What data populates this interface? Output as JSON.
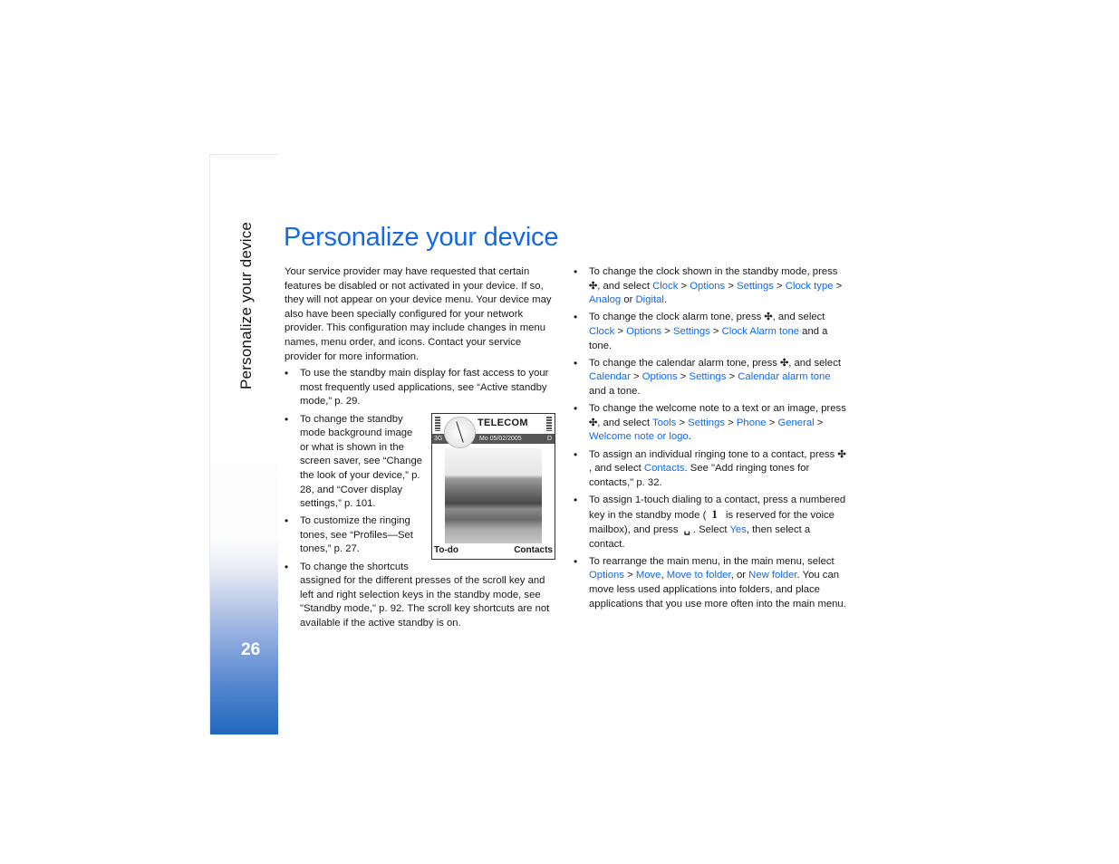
{
  "sidebar": {
    "section_title": "Personalize your device",
    "page_number": "26"
  },
  "page_title": "Personalize your device",
  "colors": {
    "link": "#1468e8",
    "sidebar_gradient_bottom": "#1f68bd"
  },
  "left_column": {
    "intro": [
      {
        "t": "Your service provider may have requested that certain features be disabled or not activated in your device. If so, they will not appear on your device menu. Your device may also have been specially configured for your network provider. This configuration may include changes in menu names, menu order, and icons. Contact your service provider for more information."
      }
    ],
    "bullets": [
      [
        {
          "t": "To use the standby main display for fast access to your most frequently used applications, see “Active standby mode,” p. 29."
        }
      ],
      [
        {
          "t": "To change the standby mode background image or what is shown in the screen saver, see “Change the look of your device,” p. 28, and “Cover display settings,” p. 101."
        }
      ],
      [
        {
          "t": "To customize the ringing tones, see “Profiles—Set tones,” p. 27."
        }
      ],
      [
        {
          "t": "To change the shortcuts assigned for the different presses of the scroll key and left and right selection keys in the standby mode, see \"Standby mode,\" p. 92. The scroll key shortcuts are not available if the active standby is on."
        }
      ]
    ]
  },
  "phone_screen": {
    "operator": "TELECOM",
    "network": "3G",
    "date": "Mo 05/02/2005",
    "indicator": "D",
    "left_softkey": "To-do",
    "right_softkey": "Contacts"
  },
  "right_column": {
    "bullets": [
      [
        {
          "t": "To change the clock shown in the standby mode, press "
        },
        {
          "icon": "menu-key"
        },
        {
          "t": ", and select "
        },
        {
          "l": "Clock"
        },
        {
          "t": " > "
        },
        {
          "l": "Options"
        },
        {
          "t": " > "
        },
        {
          "l": "Settings"
        },
        {
          "t": " > "
        },
        {
          "l": "Clock type"
        },
        {
          "t": " > "
        },
        {
          "l": "Analog"
        },
        {
          "t": " or "
        },
        {
          "l": "Digital"
        },
        {
          "t": "."
        }
      ],
      [
        {
          "t": "To change the clock alarm tone, press "
        },
        {
          "icon": "menu-key"
        },
        {
          "t": ", and select "
        },
        {
          "l": "Clock"
        },
        {
          "t": " > "
        },
        {
          "l": "Options"
        },
        {
          "t": " > "
        },
        {
          "l": "Settings"
        },
        {
          "t": " > "
        },
        {
          "l": "Clock Alarm tone"
        },
        {
          "t": " and a tone."
        }
      ],
      [
        {
          "t": "To change the calendar alarm tone, press "
        },
        {
          "icon": "menu-key"
        },
        {
          "t": ", and select "
        },
        {
          "l": "Calendar"
        },
        {
          "t": " > "
        },
        {
          "l": "Options"
        },
        {
          "t": " > "
        },
        {
          "l": "Settings"
        },
        {
          "t": " > "
        },
        {
          "l": "Calendar alarm tone"
        },
        {
          "t": " and a tone."
        }
      ],
      [
        {
          "t": "To change the welcome note to a text or an image, press "
        },
        {
          "icon": "menu-key"
        },
        {
          "t": ", and select "
        },
        {
          "l": "Tools"
        },
        {
          "t": " > "
        },
        {
          "l": "Settings"
        },
        {
          "t": " > "
        },
        {
          "l": "Phone"
        },
        {
          "t": " > "
        },
        {
          "l": "General"
        },
        {
          "t": " > "
        },
        {
          "l": "Welcome note or logo"
        },
        {
          "t": "."
        }
      ],
      [
        {
          "t": "To assign an individual ringing tone to a contact, press "
        },
        {
          "icon": "menu-key"
        },
        {
          "t": ", and select "
        },
        {
          "l": "Contacts"
        },
        {
          "t": ". See \"Add ringing tones for contacts,\" p. 32."
        }
      ],
      [
        {
          "t": "To assign 1-touch dialing to a contact, press a numbered key in the standby mode ("
        },
        {
          "icon": "one-key",
          "text": "1"
        },
        {
          "t": " is reserved for the voice mailbox), and press "
        },
        {
          "icon": "call-key"
        },
        {
          "t": ". Select "
        },
        {
          "l": "Yes"
        },
        {
          "t": ", then select a contact."
        }
      ],
      [
        {
          "t": "To rearrange the main menu, in the main menu, select "
        },
        {
          "l": "Options"
        },
        {
          "t": " > "
        },
        {
          "l": "Move"
        },
        {
          "t": ", "
        },
        {
          "l": "Move to folder"
        },
        {
          "t": ", or "
        },
        {
          "l": "New folder"
        },
        {
          "t": ". You can move less used applications into folders, and place applications that you use more often into the main menu."
        }
      ]
    ]
  }
}
